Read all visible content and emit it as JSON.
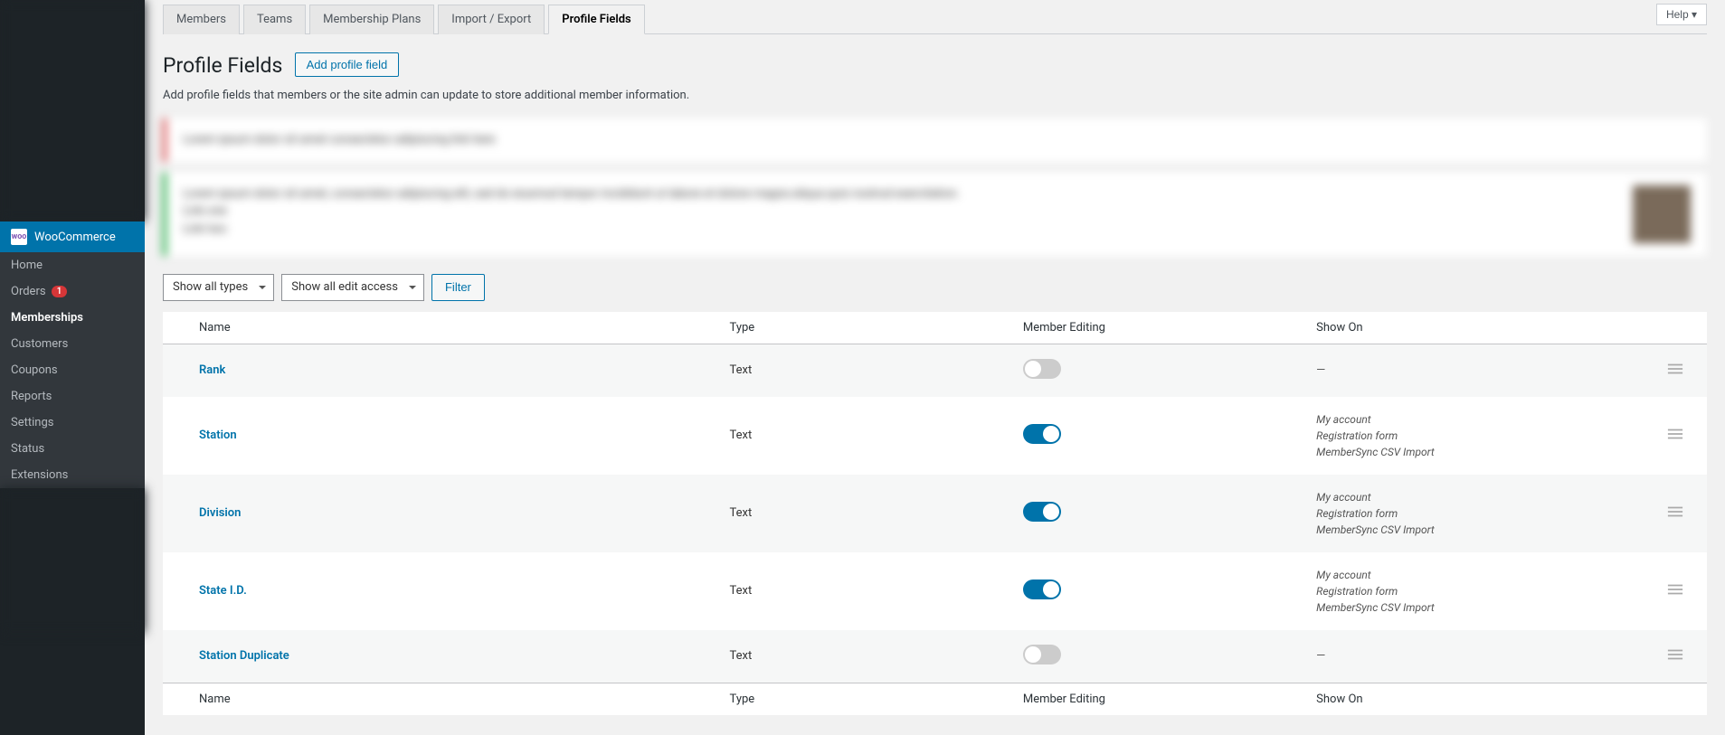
{
  "help_label": "Help ▾",
  "sidebar": {
    "woocommerce_label": "WooCommerce",
    "submenu": [
      {
        "label": "Home"
      },
      {
        "label": "Orders",
        "badge": "1"
      },
      {
        "label": "Memberships",
        "active": true
      },
      {
        "label": "Customers"
      },
      {
        "label": "Coupons"
      },
      {
        "label": "Reports"
      },
      {
        "label": "Settings"
      },
      {
        "label": "Status"
      },
      {
        "label": "Extensions"
      }
    ]
  },
  "tabs": [
    {
      "label": "Members"
    },
    {
      "label": "Teams"
    },
    {
      "label": "Membership Plans"
    },
    {
      "label": "Import / Export"
    },
    {
      "label": "Profile Fields",
      "active": true
    }
  ],
  "page_title": "Profile Fields",
  "add_button": "Add profile field",
  "description": "Add profile fields that members or the site admin can update to store additional member information.",
  "filters": {
    "type_select": "Show all types",
    "access_select": "Show all edit access",
    "filter_button": "Filter"
  },
  "columns": {
    "name": "Name",
    "type": "Type",
    "editing": "Member Editing",
    "show": "Show On"
  },
  "rows": [
    {
      "name": "Rank",
      "type": "Text",
      "editing": false,
      "show": []
    },
    {
      "name": "Station",
      "type": "Text",
      "editing": true,
      "show": [
        "My account",
        "Registration form",
        "MemberSync CSV Import"
      ]
    },
    {
      "name": "Division",
      "type": "Text",
      "editing": true,
      "show": [
        "My account",
        "Registration form",
        "MemberSync CSV Import"
      ]
    },
    {
      "name": "State I.D.",
      "type": "Text",
      "editing": true,
      "show": [
        "My account",
        "Registration form",
        "MemberSync CSV Import"
      ]
    },
    {
      "name": "Station Duplicate",
      "type": "Text",
      "editing": false,
      "show": []
    }
  ]
}
